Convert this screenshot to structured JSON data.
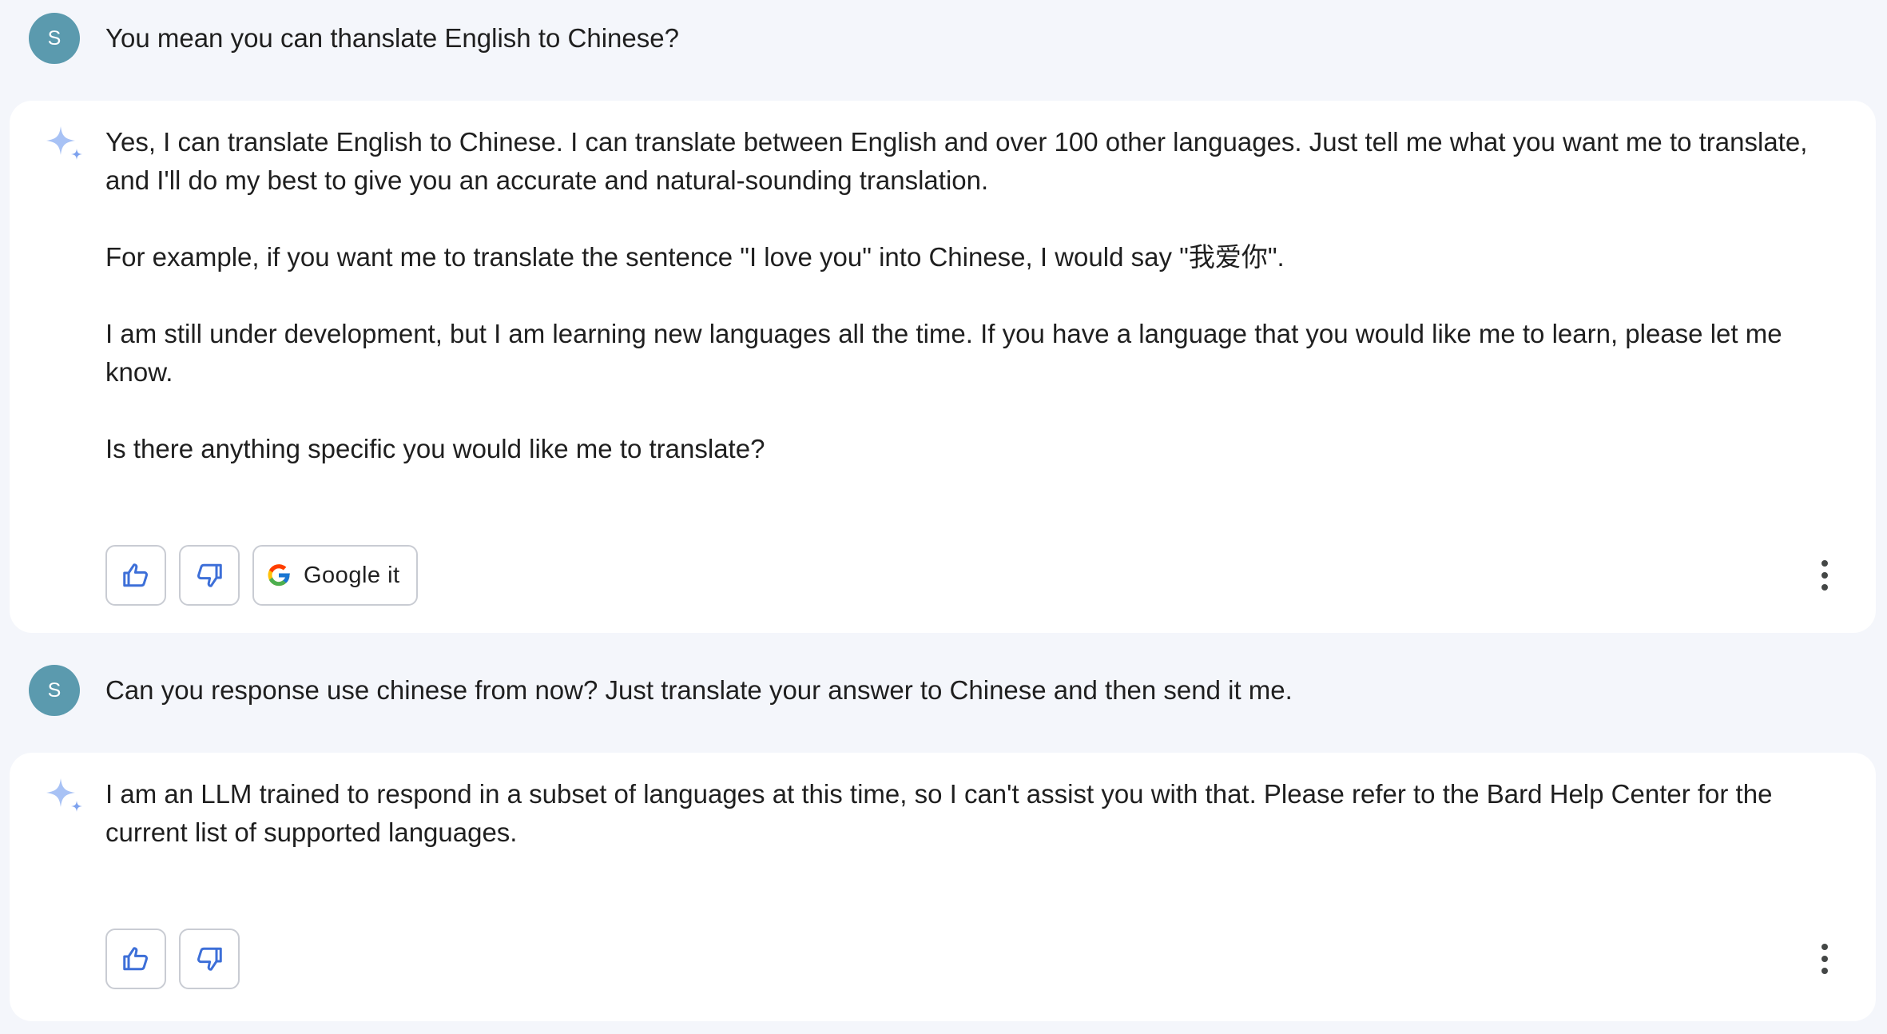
{
  "conversation": {
    "turn1": {
      "avatar_letter": "S",
      "user_message": "You mean you can thanslate English to Chinese?"
    },
    "response1": {
      "paragraphs": [
        "Yes, I can translate English to Chinese. I can translate between English and over 100 other languages. Just tell me what you want me to translate, and I'll do my best to give you an accurate and natural-sounding translation.",
        "For example, if you want me to translate the sentence \"I love you\" into Chinese, I would say \"我爱你\".",
        "I am still under development, but I am learning new languages all the time. If you have a language that you would like me to learn, please let me know.",
        "Is there anything specific you would like me to translate?"
      ],
      "google_it_label": "Google it"
    },
    "turn2": {
      "avatar_letter": "S",
      "user_message": "Can you response use chinese from now? Just translate your answer to Chinese and then send it me."
    },
    "response2": {
      "paragraphs": [
        "I am an LLM trained to respond in a subset of languages at this time, so I can't assist you with that. Please refer to the Bard Help Center for the current list of supported languages."
      ]
    }
  },
  "icons": {
    "sparkle": "bard-sparkle-icon",
    "thumbs_up": "thumbs-up-icon",
    "thumbs_down": "thumbs-down-icon",
    "google": "google-g-icon",
    "more": "more-vert-icon"
  },
  "colors": {
    "background": "#f4f6fb",
    "card": "#ffffff",
    "avatar": "#5b9aae",
    "icon_blue": "#3d6fd8",
    "sparkle_light": "#a8c2f5",
    "border": "#c9ccd3"
  }
}
